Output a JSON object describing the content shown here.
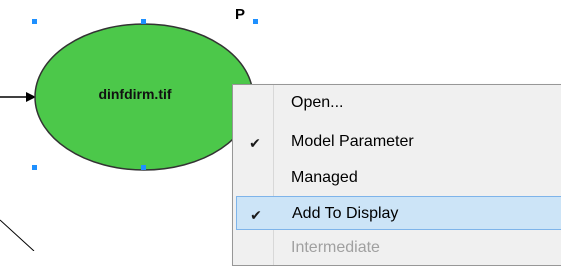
{
  "diagram": {
    "parameter_marker": "P",
    "element_label": "dinfdirm.tif",
    "element_fill": "#4cc84a"
  },
  "context_menu": {
    "items": [
      {
        "label": "Open...",
        "checked": false,
        "disabled": false,
        "highlighted": false
      },
      {
        "label": "Model Parameter",
        "checked": true,
        "disabled": false,
        "highlighted": false
      },
      {
        "label": "Managed",
        "checked": false,
        "disabled": false,
        "highlighted": false
      },
      {
        "label": "Add To Display",
        "checked": true,
        "disabled": false,
        "highlighted": true
      },
      {
        "label": "Intermediate",
        "checked": false,
        "disabled": true,
        "highlighted": false
      }
    ]
  },
  "colors": {
    "selection_handle": "#1e90ff",
    "menu_highlight": "#cce4f7",
    "menu_highlight_border": "#7eb4ea"
  }
}
